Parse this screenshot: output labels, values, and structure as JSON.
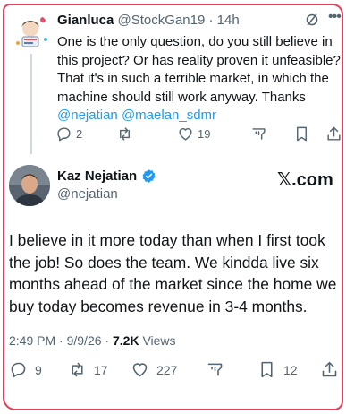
{
  "reply": {
    "name": "Gianluca",
    "handle": "@StockGan19",
    "separator": "·",
    "time": "14h",
    "text_main": "One is the only question, do you still believe in this project? Or has reality proven it unfeasible? That it's in such a terrible market, in which the machine should still work anyway. Thanks ",
    "mention_1": "@nejatian",
    "mention_2": "@maelan_sdmr",
    "actions": {
      "replies": "2",
      "likes": "19"
    }
  },
  "tweet": {
    "name": "Kaz Nejatian",
    "handle": "@nejatian",
    "brand": "𝕏.com",
    "text": "I believe in it more today than when I first took the job!  So does the team.  We kindda live six months ahead of the market since the home we buy today becomes revenue in 3-4 months.",
    "time": "2:49 PM",
    "date": "9/9/26",
    "views_count": "7.2K",
    "views_label": "Views",
    "actions": {
      "replies": "9",
      "reposts": "17",
      "likes": "227",
      "bookmarks": "12"
    }
  },
  "colors": {
    "accent": "#1d9bf0",
    "muted": "#536471",
    "annotation": "#e0405a"
  },
  "icons": [
    "grok-icon",
    "more-icon",
    "reply-icon",
    "repost-icon",
    "like-icon",
    "stats-icon",
    "bookmark-icon",
    "share-icon",
    "verified-badge-icon"
  ]
}
